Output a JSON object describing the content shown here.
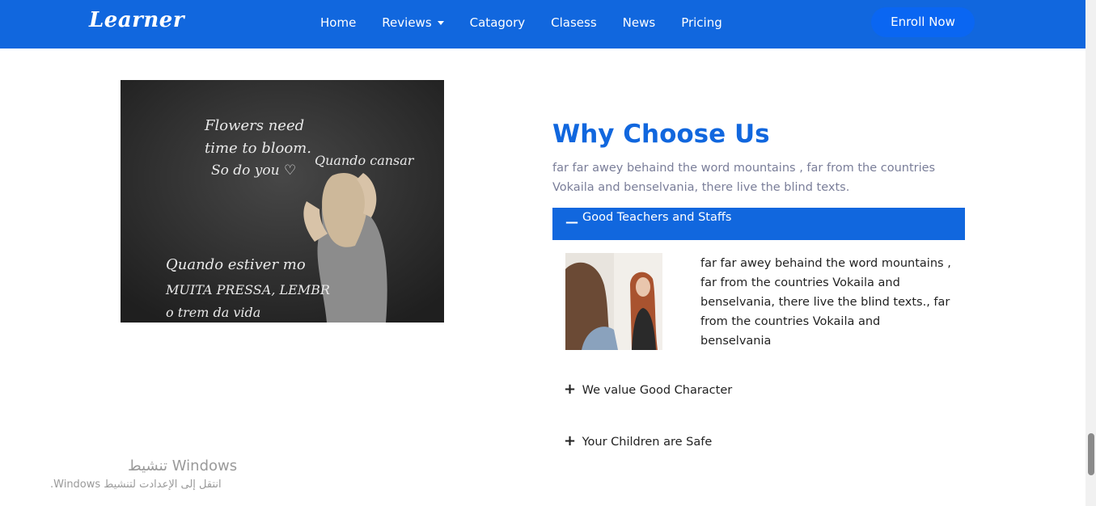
{
  "navbar": {
    "logo": "Learner",
    "items": [
      {
        "label": "Home"
      },
      {
        "label": "Reviews"
      },
      {
        "label": "Catagory"
      },
      {
        "label": "Clasess"
      },
      {
        "label": "News"
      },
      {
        "label": "Pricing"
      }
    ],
    "cta": "Enroll Now",
    "color": "#1167de"
  },
  "hero_image": {
    "chalk_lines": [
      "Flowers need",
      "time to bloom.",
      "So do you ♡",
      "Quando cansar",
      "Quando estiver mo",
      "MUITA PRESSA, LEMBR",
      "o trem da vida"
    ]
  },
  "section": {
    "title": "Why Choose Us",
    "intro": "far far awey behaind the word mountains , far from the countries Vokaila and benselvania, there live the blind texts."
  },
  "accordion": [
    {
      "symbol": "—",
      "label": "Good Teachers and Staffs",
      "expanded": true,
      "body": "far far awey behaind the word mountains , far from the countries Vokaila and benselvania, there live the blind texts., far from the countries Vokaila and benselvania"
    },
    {
      "symbol": "+",
      "label": "We value Good Character",
      "expanded": false
    },
    {
      "symbol": "+",
      "label": "Your Children are Safe",
      "expanded": false
    }
  ],
  "watermark": {
    "line1": "تنشيط Windows",
    "line2": "انتقل إلى الإعدادت لتنشيط Windows."
  }
}
